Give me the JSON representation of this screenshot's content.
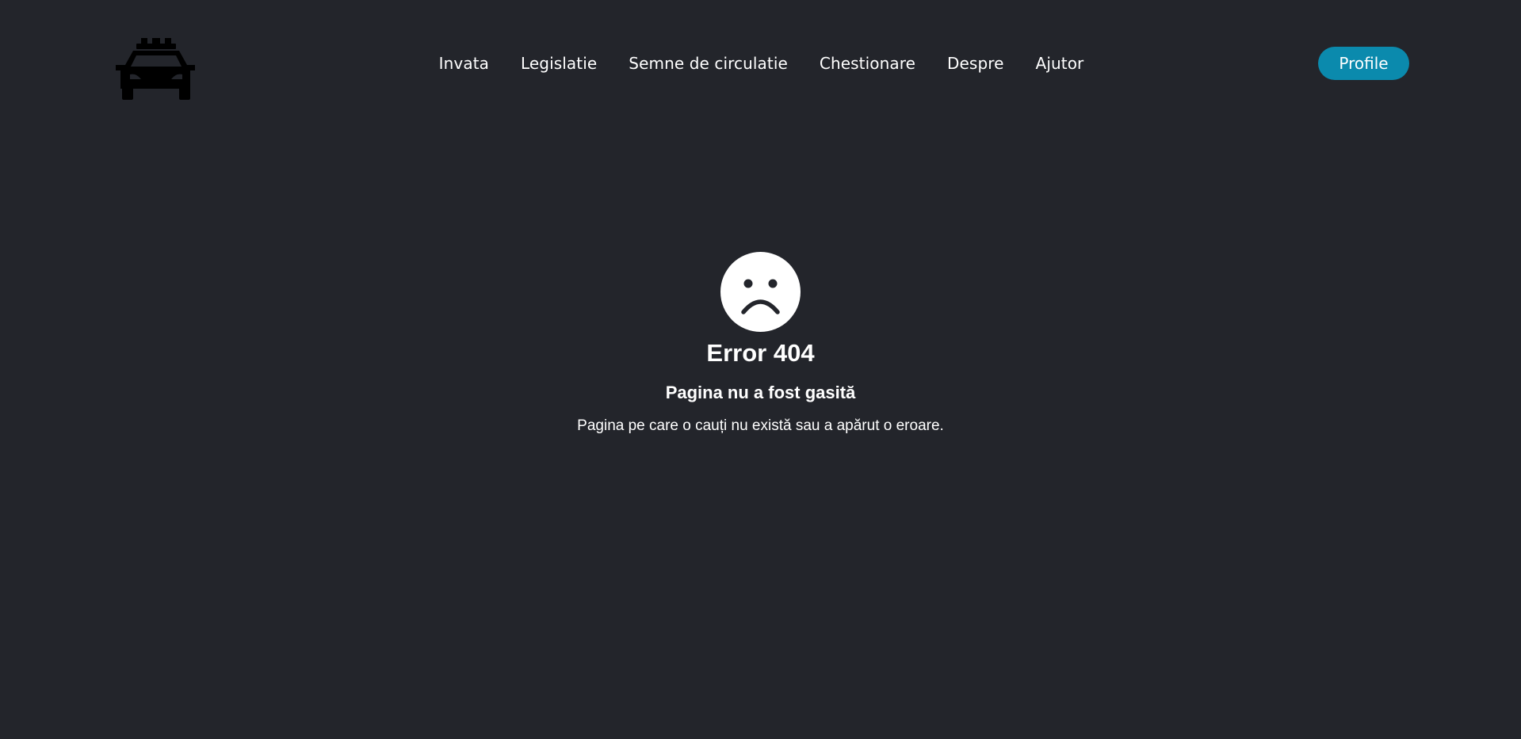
{
  "header": {
    "logo_icon": "taxi-car-icon",
    "nav": [
      {
        "label": "Invata"
      },
      {
        "label": "Legislatie"
      },
      {
        "label": "Semne de circulatie"
      },
      {
        "label": "Chestionare"
      },
      {
        "label": "Despre"
      },
      {
        "label": "Ajutor"
      }
    ],
    "profile_label": "Profile"
  },
  "error": {
    "icon": "sad-face-icon",
    "title": "Error 404",
    "subtitle": "Pagina nu a fost gasită",
    "message": "Pagina pe care o cauți nu există sau a apărut o eroare."
  },
  "colors": {
    "background": "#23252b",
    "accent": "#0b8aad",
    "text": "#ffffff",
    "logo": "#000000"
  }
}
